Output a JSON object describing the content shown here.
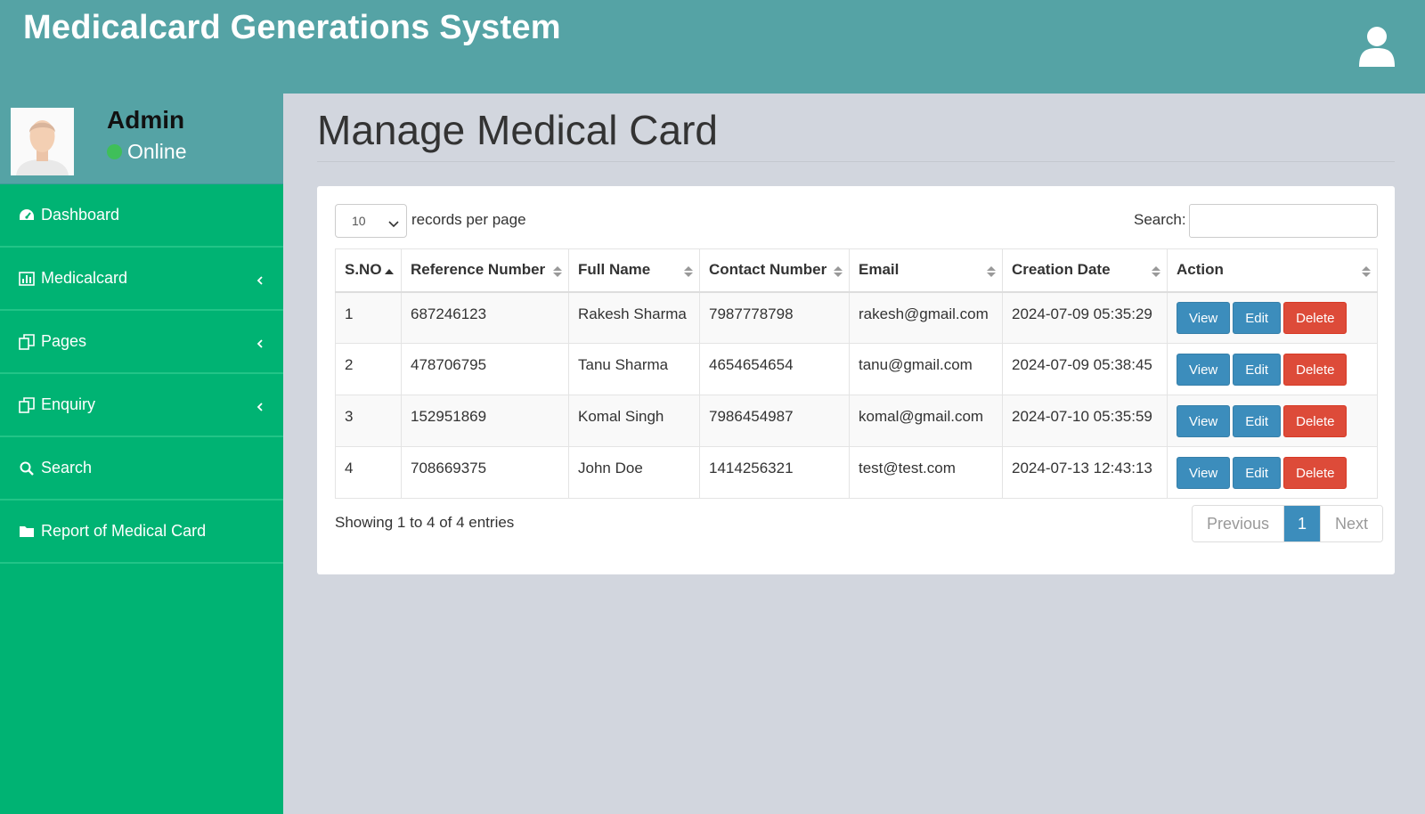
{
  "header": {
    "app_title": "Medicalcard Generations System",
    "user_icon": "user-icon"
  },
  "user_panel": {
    "name": "Admin",
    "status": "Online",
    "status_color": "#3fbf59"
  },
  "sidebar": {
    "background": "#00b373",
    "items": [
      {
        "label": "Dashboard",
        "icon": "dashboard-icon",
        "has_submenu": false
      },
      {
        "label": "Medicalcard",
        "icon": "bar-chart-icon",
        "has_submenu": true
      },
      {
        "label": "Pages",
        "icon": "copy-icon",
        "has_submenu": true
      },
      {
        "label": "Enquiry",
        "icon": "copy-icon",
        "has_submenu": true
      },
      {
        "label": "Search",
        "icon": "search-icon",
        "has_submenu": false
      },
      {
        "label": "Report of Medical Card",
        "icon": "folder-icon",
        "has_submenu": false
      }
    ]
  },
  "main": {
    "page_title": "Manage Medical Card",
    "length_menu": {
      "value": "10",
      "label": "records per page"
    },
    "search": {
      "label": "Search:",
      "value": ""
    },
    "table": {
      "columns": [
        "S.NO",
        "Reference Number",
        "Full Name",
        "Contact Number",
        "Email",
        "Creation Date",
        "Action"
      ],
      "rows": [
        {
          "sno": "1",
          "ref": "687246123",
          "name": "Rakesh Sharma",
          "contact": "7987778798",
          "email": "rakesh@gmail.com",
          "date": "2024-07-09 05:35:29"
        },
        {
          "sno": "2",
          "ref": "478706795",
          "name": "Tanu Sharma",
          "contact": "4654654654",
          "email": "tanu@gmail.com",
          "date": "2024-07-09 05:38:45"
        },
        {
          "sno": "3",
          "ref": "152951869",
          "name": "Komal Singh",
          "contact": "7986454987",
          "email": "komal@gmail.com",
          "date": "2024-07-10 05:35:59"
        },
        {
          "sno": "4",
          "ref": "708669375",
          "name": "John Doe",
          "contact": "1414256321",
          "email": "test@test.com",
          "date": "2024-07-13 12:43:13"
        }
      ],
      "actions": {
        "view": "View",
        "edit": "Edit",
        "delete": "Delete"
      }
    },
    "info": "Showing 1 to 4 of 4 entries",
    "pagination": {
      "previous": "Previous",
      "current": "1",
      "next": "Next"
    }
  }
}
